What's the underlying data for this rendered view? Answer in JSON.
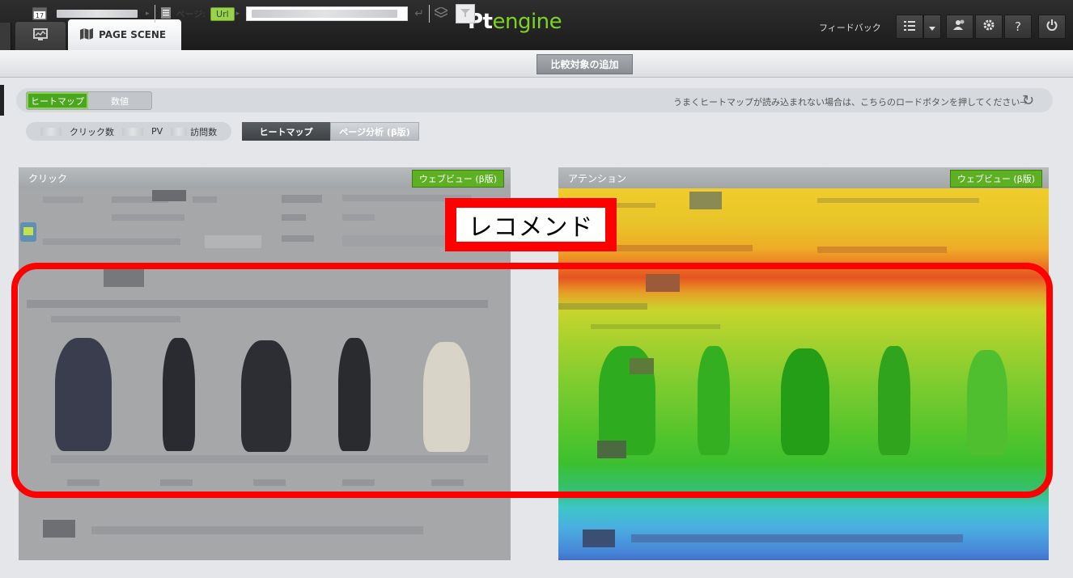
{
  "app": {
    "tabs": [
      {
        "name": "monitor",
        "icon": "monitor-icon"
      },
      {
        "name": "page-scene",
        "label": "PAGE SCENE",
        "icon": "map-icon"
      }
    ],
    "logo": {
      "prefix": "Pt",
      "suffix": "engine"
    },
    "feedback_label": "フィードバック",
    "toolbar_icons": [
      "list-icon",
      "caret-down-icon",
      "users-icon",
      "gear-icon",
      "help-icon",
      "power-icon"
    ],
    "help_glyph": "?"
  },
  "subbar": {
    "date_icon_day": "17",
    "page_label": "ページ:",
    "url_badge": "Url",
    "compare_button": "比較対象の追加"
  },
  "mode": {
    "heatmap_tab": "ヒートマップ",
    "numbers_tab": "数値",
    "notice": "うまくヒートマップが読み込まれない場合は、こちらのロードボタンを押してください→"
  },
  "metrics": {
    "clicks": "クリック数",
    "pv": "PV",
    "visits": "訪問数",
    "heatmap_button": "ヒートマップ",
    "page_analysis_button": "ページ分析 (β版)"
  },
  "panels": {
    "left": {
      "title": "クリック",
      "webview": "ウェブビュー (β版)"
    },
    "right": {
      "title": "アテンション",
      "webview": "ウェブビュー (β版)"
    }
  },
  "annotation": {
    "label": "レコメンド",
    "color": "#ff0000"
  }
}
